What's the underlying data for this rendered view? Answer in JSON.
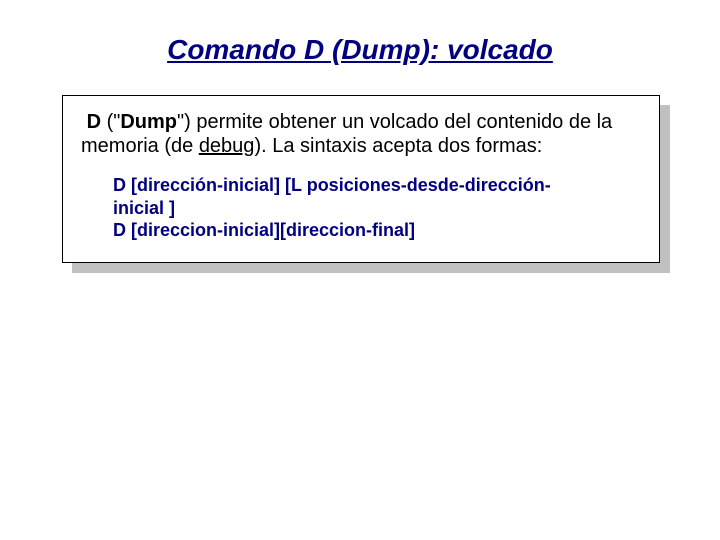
{
  "title": "Comando D (Dump): volcado",
  "intro": {
    "lead_space": " ",
    "cmd": "D",
    "open_q": " (\"",
    "dump_word": "Dump",
    "close_q": "\") ",
    "rest1": "permite obtener un volcado del contenido de la memoria (de ",
    "debug_word": "debug",
    "rest2": ").  La sintaxis acepta dos formas:"
  },
  "syntax": {
    "line1a": "D [dirección-inicial] [L posiciones-desde-dirección-",
    "line1b": "inicial ]",
    "line2": "D [direccion-inicial][direccion-final]"
  }
}
